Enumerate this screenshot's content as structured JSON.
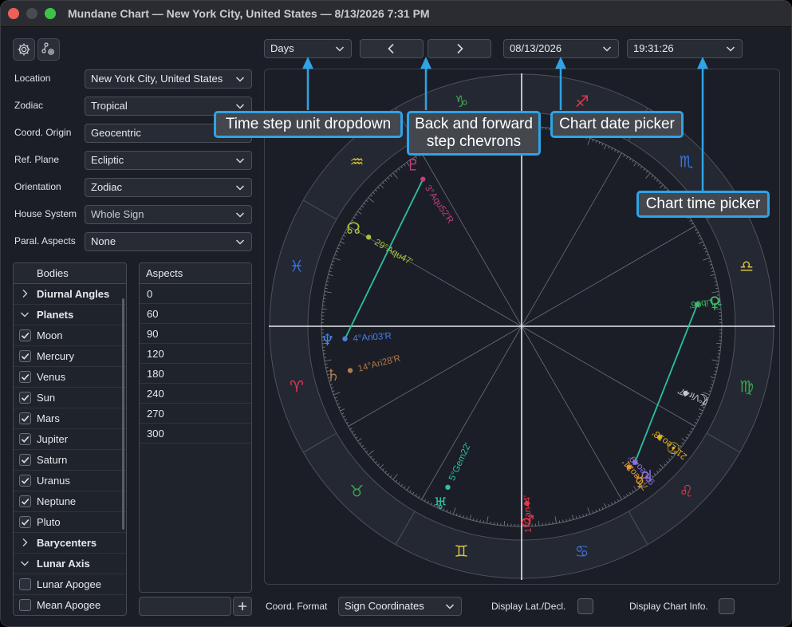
{
  "window": {
    "title": "Mundane Chart — New York City, United States — 8/13/2026 7:31 PM"
  },
  "toolbar": {
    "icons": [
      "gear-icon",
      "chart-settings-icon"
    ]
  },
  "settings": [
    {
      "label": "Location",
      "value": "New York City, United States"
    },
    {
      "label": "Zodiac",
      "value": "Tropical"
    },
    {
      "label": "Coord. Origin",
      "value": "Geocentric"
    },
    {
      "label": "Ref. Plane",
      "value": "Ecliptic"
    },
    {
      "label": "Orientation",
      "value": "Zodiac"
    },
    {
      "label": "House System",
      "value": "Whole Sign"
    },
    {
      "label": "Paral. Aspects",
      "value": "None"
    }
  ],
  "bodies": {
    "header": "Bodies",
    "rows": [
      {
        "type": "group",
        "label": "Diurnal Angles",
        "expanded": false
      },
      {
        "type": "group",
        "label": "Planets",
        "expanded": true
      },
      {
        "type": "item",
        "label": "Moon",
        "checked": true
      },
      {
        "type": "item",
        "label": "Mercury",
        "checked": true
      },
      {
        "type": "item",
        "label": "Venus",
        "checked": true
      },
      {
        "type": "item",
        "label": "Sun",
        "checked": true
      },
      {
        "type": "item",
        "label": "Mars",
        "checked": true
      },
      {
        "type": "item",
        "label": "Jupiter",
        "checked": true
      },
      {
        "type": "item",
        "label": "Saturn",
        "checked": true
      },
      {
        "type": "item",
        "label": "Uranus",
        "checked": true
      },
      {
        "type": "item",
        "label": "Neptune",
        "checked": true
      },
      {
        "type": "item",
        "label": "Pluto",
        "checked": true
      },
      {
        "type": "group",
        "label": "Barycenters",
        "expanded": false
      },
      {
        "type": "group",
        "label": "Lunar Axis",
        "expanded": true
      },
      {
        "type": "item",
        "label": "Lunar Apogee",
        "checked": false
      },
      {
        "type": "item",
        "label": "Mean Apogee",
        "checked": false
      }
    ]
  },
  "aspects": {
    "header": "Aspects",
    "rows": [
      "0",
      "60",
      "90",
      "120",
      "180",
      "240",
      "270",
      "300"
    ]
  },
  "time_controls": {
    "step_unit": "Days",
    "date": "08/13/2026",
    "time": "19:31:26"
  },
  "bottom": {
    "coord_format_label": "Coord. Format",
    "coord_format_value": "Sign Coordinates",
    "display_lat_label": "Display Lat./Decl.",
    "display_info_label": "Display Chart Info."
  },
  "callouts": {
    "step_unit": "Time step unit dropdown",
    "chevrons": "Back and forward step chevrons",
    "date": "Chart date picker",
    "time": "Chart time picker"
  },
  "chart": {
    "signs": [
      {
        "glyph": "♈",
        "color": "#e0394a"
      },
      {
        "glyph": "♉",
        "color": "#3aa44a"
      },
      {
        "glyph": "♊",
        "color": "#d8c23a"
      },
      {
        "glyph": "♋",
        "color": "#3a74d8"
      },
      {
        "glyph": "♌",
        "color": "#e0394a"
      },
      {
        "glyph": "♍",
        "color": "#3aa44a"
      },
      {
        "glyph": "♎",
        "color": "#d8c23a"
      },
      {
        "glyph": "♏",
        "color": "#3a74d8"
      },
      {
        "glyph": "♐",
        "color": "#e0394a"
      },
      {
        "glyph": "♑",
        "color": "#3aa44a"
      },
      {
        "glyph": "♒",
        "color": "#d8c23a"
      },
      {
        "glyph": "♓",
        "color": "#3a74d8"
      }
    ],
    "bodies": [
      {
        "name": "Moon",
        "glyph": "☽",
        "label": "7°Vir47'",
        "lon": 157.78,
        "color": "#c9c9c9"
      },
      {
        "name": "Venus",
        "glyph": "♀",
        "label": "7°Lib06'",
        "lon": 187.1,
        "color": "#3fb86a"
      },
      {
        "name": "Sun",
        "glyph": "☉",
        "label": "21°Leo13'",
        "lon": 141.22,
        "color": "#e2b21c"
      },
      {
        "name": "Jupiter",
        "glyph": "♃",
        "label": "9°Leo49'",
        "lon": 129.82,
        "color": "#8f6ee0"
      },
      {
        "name": "Mercury",
        "glyph": "☿",
        "label": "7°Leo21'",
        "lon": 127.35,
        "color": "#e59a2a"
      },
      {
        "name": "Mars",
        "glyph": "♂",
        "label": "1°Can44'",
        "lon": 91.73,
        "color": "#e0394a"
      },
      {
        "name": "Uranus",
        "glyph": "♅",
        "label": "5°Gem22'",
        "lon": 65.37,
        "color": "#2cc0a0"
      },
      {
        "name": "Saturn",
        "glyph": "♄",
        "label": "14°Ari28'R",
        "lon": 14.47,
        "color": "#b07a4a"
      },
      {
        "name": "Neptune",
        "glyph": "♆",
        "label": "4°Ari03'R",
        "lon": 4.05,
        "color": "#4a7fe6"
      },
      {
        "name": "North Node",
        "glyph": "☊",
        "label": "29°Aqu47'",
        "lon": 329.78,
        "color": "#a8c23a"
      },
      {
        "name": "Pluto",
        "glyph": "♇",
        "label": "3°Aqu52'R",
        "lon": 303.87,
        "color": "#c0407a"
      }
    ],
    "aspect_lines": [
      {
        "from": "Neptune",
        "to": "Pluto",
        "color": "#2cc0a0"
      },
      {
        "from": "Venus",
        "to": "Jupiter",
        "color": "#2cc0a0"
      }
    ]
  }
}
